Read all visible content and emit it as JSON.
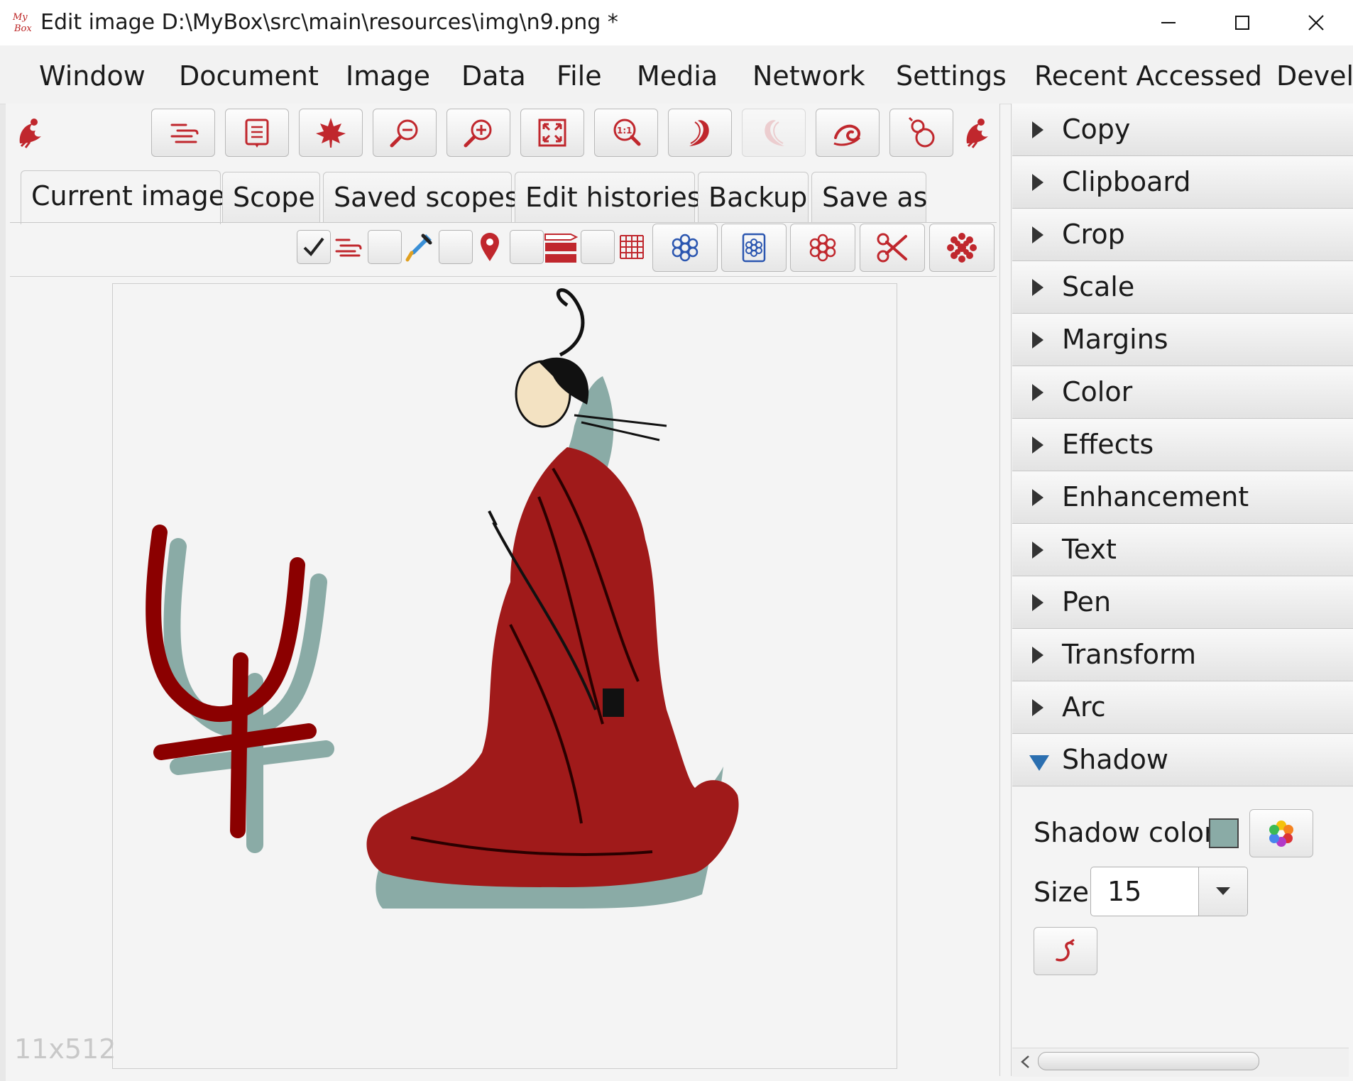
{
  "window": {
    "title": "Edit image D:\\MyBox\\src\\main\\resources\\img\\n9.png  *",
    "logo_text": "My Box"
  },
  "menu": [
    "Window",
    "Document",
    "Image",
    "Data",
    "File",
    "Media",
    "Network",
    "Settings",
    "Recent Accessed",
    "Develo"
  ],
  "toolbar": {
    "icons": [
      "menu-lines-icon",
      "notes-icon",
      "maple-leaf-icon",
      "zoom-out-icon",
      "zoom-in-icon",
      "fit-screen-icon",
      "actual-size-icon",
      "undo-curve-icon",
      "redo-curve-icon",
      "swirl-icon",
      "gourd-icon"
    ]
  },
  "tabs": [
    "Current image",
    "Scope",
    "Saved scopes",
    "Edit histories",
    "Backup",
    "Save as"
  ],
  "scope_bar": {
    "icons": [
      "lines-icon",
      "eyedropper-icon",
      "location-pin-icon",
      "color-bar-icon",
      "grid-icon",
      "flower-outline-icon",
      "flower-square-icon",
      "flower-cluster-icon",
      "scissors-icon",
      "chrysanthemum-icon"
    ]
  },
  "image": {
    "dimensions_label": "11x512",
    "colors": {
      "robe": "#a01a1a",
      "shadow": "#8aaba6",
      "skin": "#f3e2c2"
    }
  },
  "operations": [
    "Copy",
    "Clipboard",
    "Crop",
    "Scale",
    "Margins",
    "Color",
    "Effects",
    "Enhancement",
    "Text",
    "Pen",
    "Transform",
    "Arc",
    "Shadow"
  ],
  "shadow_panel": {
    "color_label": "Shadow color",
    "color_value": "#8aaba6",
    "size_label": "Size",
    "size_value": "15"
  },
  "accent_color": "#c0272d"
}
